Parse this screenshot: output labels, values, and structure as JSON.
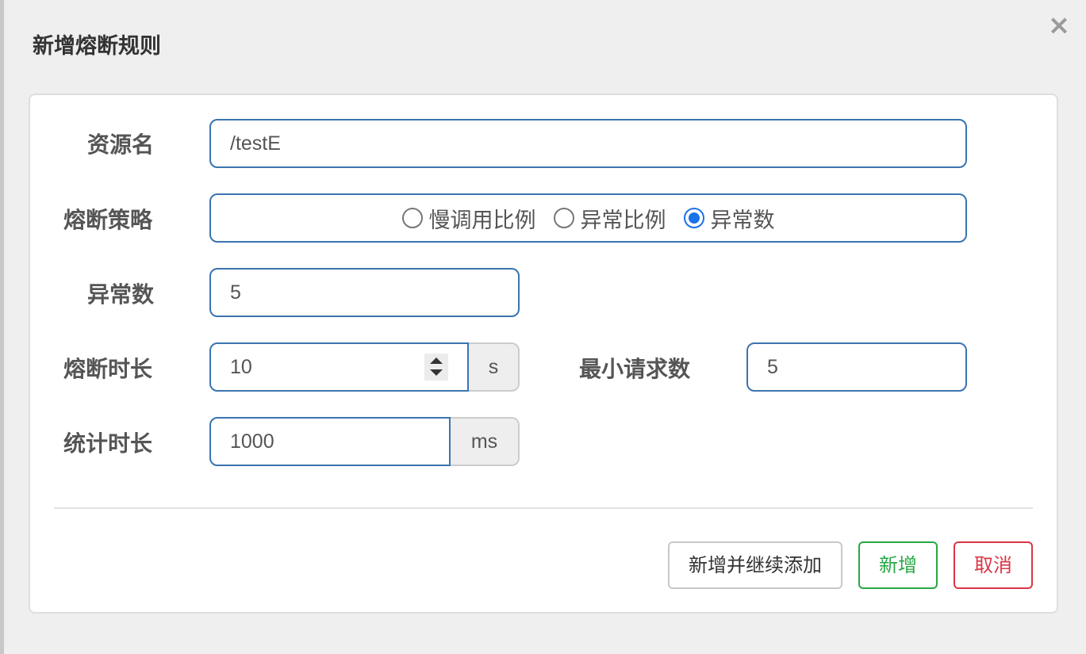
{
  "dialog": {
    "title": "新增熔断规则",
    "close_symbol": "×"
  },
  "form": {
    "resource": {
      "label": "资源名",
      "value": "/testE"
    },
    "strategy": {
      "label": "熔断策略",
      "options": [
        {
          "label": "慢调用比例",
          "checked": false
        },
        {
          "label": "异常比例",
          "checked": false
        },
        {
          "label": "异常数",
          "checked": true
        }
      ]
    },
    "exception_count": {
      "label": "异常数",
      "value": "5"
    },
    "break_duration": {
      "label": "熔断时长",
      "value": "10",
      "unit": "s"
    },
    "min_request": {
      "label": "最小请求数",
      "value": "5"
    },
    "stat_interval": {
      "label": "统计时长",
      "value": "1000",
      "unit": "ms"
    }
  },
  "buttons": {
    "add_continue": "新增并继续添加",
    "add": "新增",
    "cancel": "取消"
  },
  "colors": {
    "accent": "#3a74b0",
    "radio_checked": "#1a73e8",
    "success": "#28a745",
    "danger": "#dc3545"
  }
}
